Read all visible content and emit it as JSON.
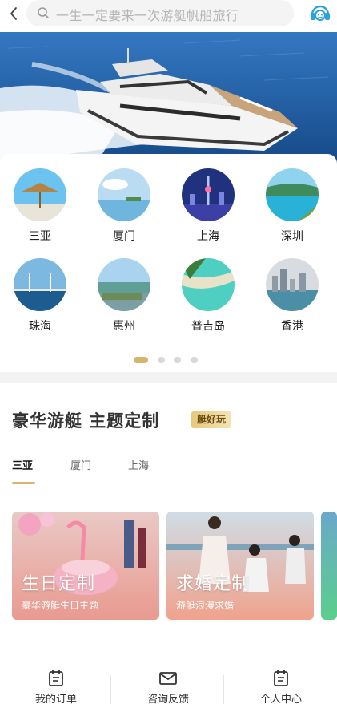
{
  "search": {
    "placeholder": "一生一定要来一次游艇帆船旅行"
  },
  "destinations": [
    {
      "name": "三亚"
    },
    {
      "name": "厦门"
    },
    {
      "name": "上海"
    },
    {
      "name": "深圳"
    },
    {
      "name": "珠海"
    },
    {
      "name": "惠州"
    },
    {
      "name": "普吉岛"
    },
    {
      "name": "香港"
    }
  ],
  "pagination": {
    "pages": 4,
    "active": 1
  },
  "theme": {
    "title": "豪华游艇 主题定制",
    "badge": "艇好玩",
    "tabs": [
      {
        "label": "三亚"
      },
      {
        "label": "厦门"
      },
      {
        "label": "上海"
      }
    ],
    "active_tab": "三亚",
    "cards": [
      {
        "title": "生日定制",
        "subtitle": "豪华游艇生日主题"
      },
      {
        "title": "求婚定制",
        "subtitle": "游艇浪漫求婚"
      }
    ]
  },
  "bottom_nav": [
    {
      "label": "我的订单",
      "icon": "calendar-icon"
    },
    {
      "label": "咨询反馈",
      "icon": "mail-icon"
    },
    {
      "label": "个人中心",
      "icon": "calendar-icon"
    }
  ],
  "colors": {
    "accent": "#d6b56a",
    "badge": "#e6c87d",
    "search_bg": "#f4f4f4",
    "service": "#2aa3e0"
  }
}
